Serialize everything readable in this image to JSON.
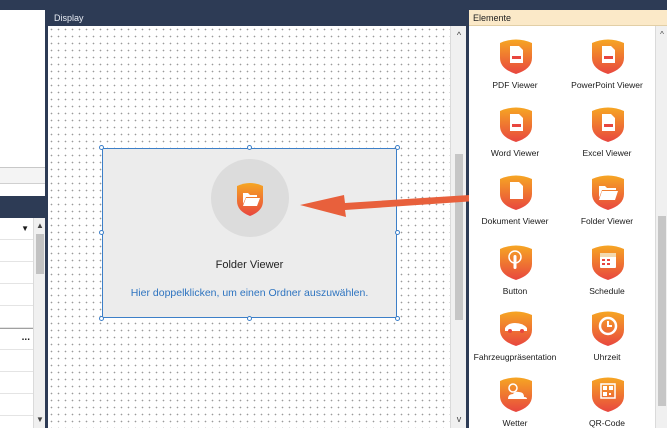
{
  "display_panel": {
    "title": "Display"
  },
  "widget": {
    "title": "Folder Viewer",
    "hint": "Hier doppelklicken, um einen Ordner auszuwählen."
  },
  "elements_panel": {
    "title": "Elemente",
    "items": [
      {
        "label": "PDF Viewer",
        "icon": "pdf-icon"
      },
      {
        "label": "PowerPoint Viewer",
        "icon": "powerpoint-icon"
      },
      {
        "label": "Word Viewer",
        "icon": "word-icon"
      },
      {
        "label": "Excel Viewer",
        "icon": "excel-icon"
      },
      {
        "label": "Dokument Viewer",
        "icon": "document-icon"
      },
      {
        "label": "Folder Viewer",
        "icon": "folder-icon"
      },
      {
        "label": "Button",
        "icon": "touch-icon"
      },
      {
        "label": "Schedule",
        "icon": "calendar-icon"
      },
      {
        "label": "Fahrzeugpräsentation",
        "icon": "car-icon"
      },
      {
        "label": "Uhrzeit",
        "icon": "clock-icon"
      },
      {
        "label": "Wetter",
        "icon": "weather-icon"
      },
      {
        "label": "QR-Code",
        "icon": "qr-code-icon"
      }
    ]
  },
  "left_panel": {
    "ellipsis": "..."
  },
  "colors": {
    "accent": "#e8584a",
    "gradient_top": "#f6a623",
    "selection": "#3c7fc8",
    "arrow": "#e8603c"
  }
}
